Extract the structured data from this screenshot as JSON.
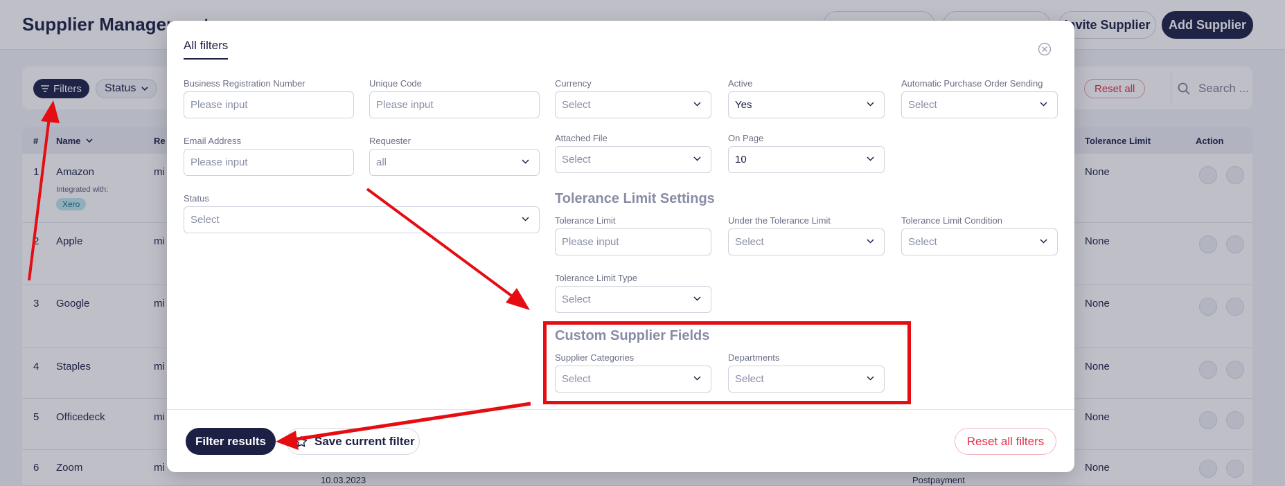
{
  "page": {
    "title": "Supplier Management",
    "top_buttons": [
      {
        "label": ""
      },
      {
        "label": ""
      },
      {
        "label": "Invite Supplier"
      },
      {
        "label": "Add Supplier"
      }
    ],
    "filterbar": {
      "filters_label": "Filters",
      "status_label": "Status",
      "reset_label": "Reset all",
      "search_placeholder": "Search ..."
    },
    "table": {
      "headers": {
        "num": "#",
        "name": "Name",
        "req": "Re",
        "tolerance": "Tolerance Limit",
        "action": "Action"
      },
      "rows": [
        {
          "num": "1",
          "name": "Amazon",
          "req": "mi",
          "integrated_label": "Integrated with:",
          "badge": "Xero",
          "tolerance": "None"
        },
        {
          "num": "2",
          "name": "Apple",
          "req": "mi",
          "tolerance": "None"
        },
        {
          "num": "3",
          "name": "Google",
          "req": "mi",
          "tolerance": "None"
        },
        {
          "num": "4",
          "name": "Staples",
          "req": "mi",
          "tolerance": "None"
        },
        {
          "num": "5",
          "name": "Officedeck",
          "req": "mi",
          "tolerance": "None"
        },
        {
          "num": "6",
          "name": "Zoom",
          "req": "mi",
          "tolerance": "None",
          "date": "10.03.2023",
          "payment": "Postpayment"
        }
      ]
    }
  },
  "modal": {
    "tab_label": "All filters",
    "fields": {
      "brn": {
        "label": "Business Registration Number",
        "placeholder": "Please input"
      },
      "unique_code": {
        "label": "Unique Code",
        "placeholder": "Please input"
      },
      "email": {
        "label": "Email Address",
        "placeholder": "Please input"
      },
      "requester": {
        "label": "Requester",
        "value": "all"
      },
      "status": {
        "label": "Status",
        "value": "Select"
      },
      "currency": {
        "label": "Currency",
        "value": "Select"
      },
      "active": {
        "label": "Active",
        "value": "Yes"
      },
      "auto_po": {
        "label": "Automatic Purchase Order Sending",
        "value": "Select"
      },
      "attached_file": {
        "label": "Attached File",
        "value": "Select"
      },
      "on_page": {
        "label": "On Page",
        "value": "10"
      },
      "tolerance_limit": {
        "label": "Tolerance Limit",
        "placeholder": "Please input"
      },
      "under_tolerance": {
        "label": "Under the Tolerance Limit",
        "value": "Select"
      },
      "tolerance_condition": {
        "label": "Tolerance Limit Condition",
        "value": "Select"
      },
      "tolerance_type": {
        "label": "Tolerance Limit Type",
        "value": "Select"
      },
      "supplier_categories": {
        "label": "Supplier Categories",
        "value": "Select"
      },
      "departments": {
        "label": "Departments",
        "value": "Select"
      }
    },
    "sections": {
      "tolerance": "Tolerance Limit Settings",
      "custom": "Custom Supplier Fields"
    },
    "buttons": {
      "filter_results": "Filter results",
      "save_filter": "Save current filter",
      "reset_all": "Reset all filters"
    }
  },
  "colors": {
    "primary": "#1c2045",
    "danger": "#e0304a",
    "annotation": "#e50d12"
  }
}
